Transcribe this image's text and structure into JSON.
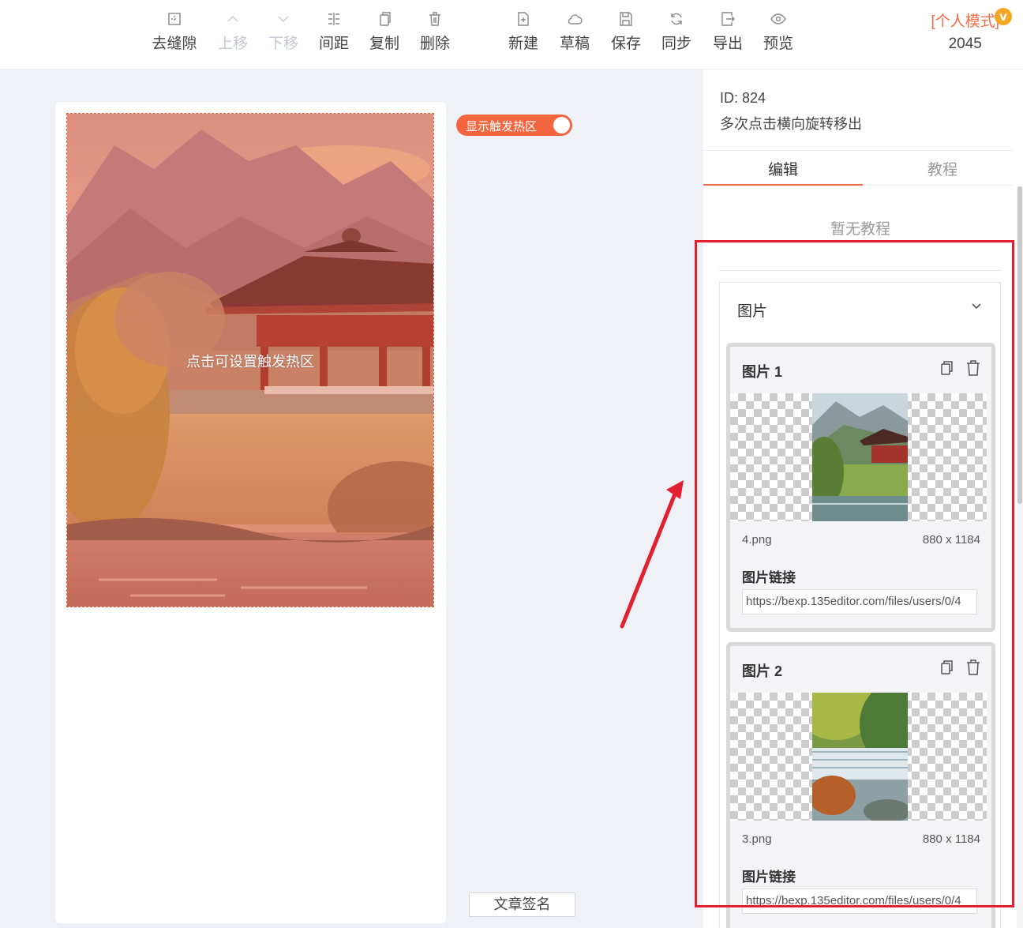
{
  "toolbar": {
    "items": [
      {
        "label": "去缝隙",
        "icon": "remove-gap-icon",
        "disabled": false
      },
      {
        "label": "上移",
        "icon": "chevron-up-icon",
        "disabled": true
      },
      {
        "label": "下移",
        "icon": "chevron-down-icon",
        "disabled": true
      },
      {
        "label": "间距",
        "icon": "spacing-icon",
        "disabled": false
      },
      {
        "label": "复制",
        "icon": "copy-icon",
        "disabled": false
      },
      {
        "label": "删除",
        "icon": "trash-icon",
        "disabled": false
      },
      {
        "label": "新建",
        "icon": "new-file-icon",
        "disabled": false
      },
      {
        "label": "草稿",
        "icon": "cloud-icon",
        "disabled": false
      },
      {
        "label": "保存",
        "icon": "save-icon",
        "disabled": false
      },
      {
        "label": "同步",
        "icon": "sync-icon",
        "disabled": false
      },
      {
        "label": "导出",
        "icon": "export-icon",
        "disabled": false
      },
      {
        "label": "预览",
        "icon": "eye-icon",
        "disabled": false
      }
    ],
    "mode_label": "[个人模式]",
    "vip_badge": "v",
    "count": "2045"
  },
  "canvas": {
    "hint": "点击可设置触发热区",
    "toggle_label": "显示触发热区",
    "sign_button": "文章签名"
  },
  "panel": {
    "id_label": "ID: 824",
    "description": "多次点击横向旋转移出",
    "tabs": [
      {
        "label": "编辑"
      },
      {
        "label": "教程"
      }
    ],
    "no_tutorial": "暂无教程",
    "section_title": "图片",
    "images": [
      {
        "title": "图片 1",
        "filename": "4.png",
        "size": "880 x 1184",
        "link_label": "图片链接",
        "link": "https://bexp.135editor.com/files/users/0/4"
      },
      {
        "title": "图片 2",
        "filename": "3.png",
        "size": "880 x 1184",
        "link_label": "图片链接",
        "link": "https://bexp.135editor.com/files/users/0/4"
      }
    ]
  },
  "colors": {
    "accent": "#f36c45",
    "highlight": "#e3202f",
    "vip": "#f5a623"
  }
}
